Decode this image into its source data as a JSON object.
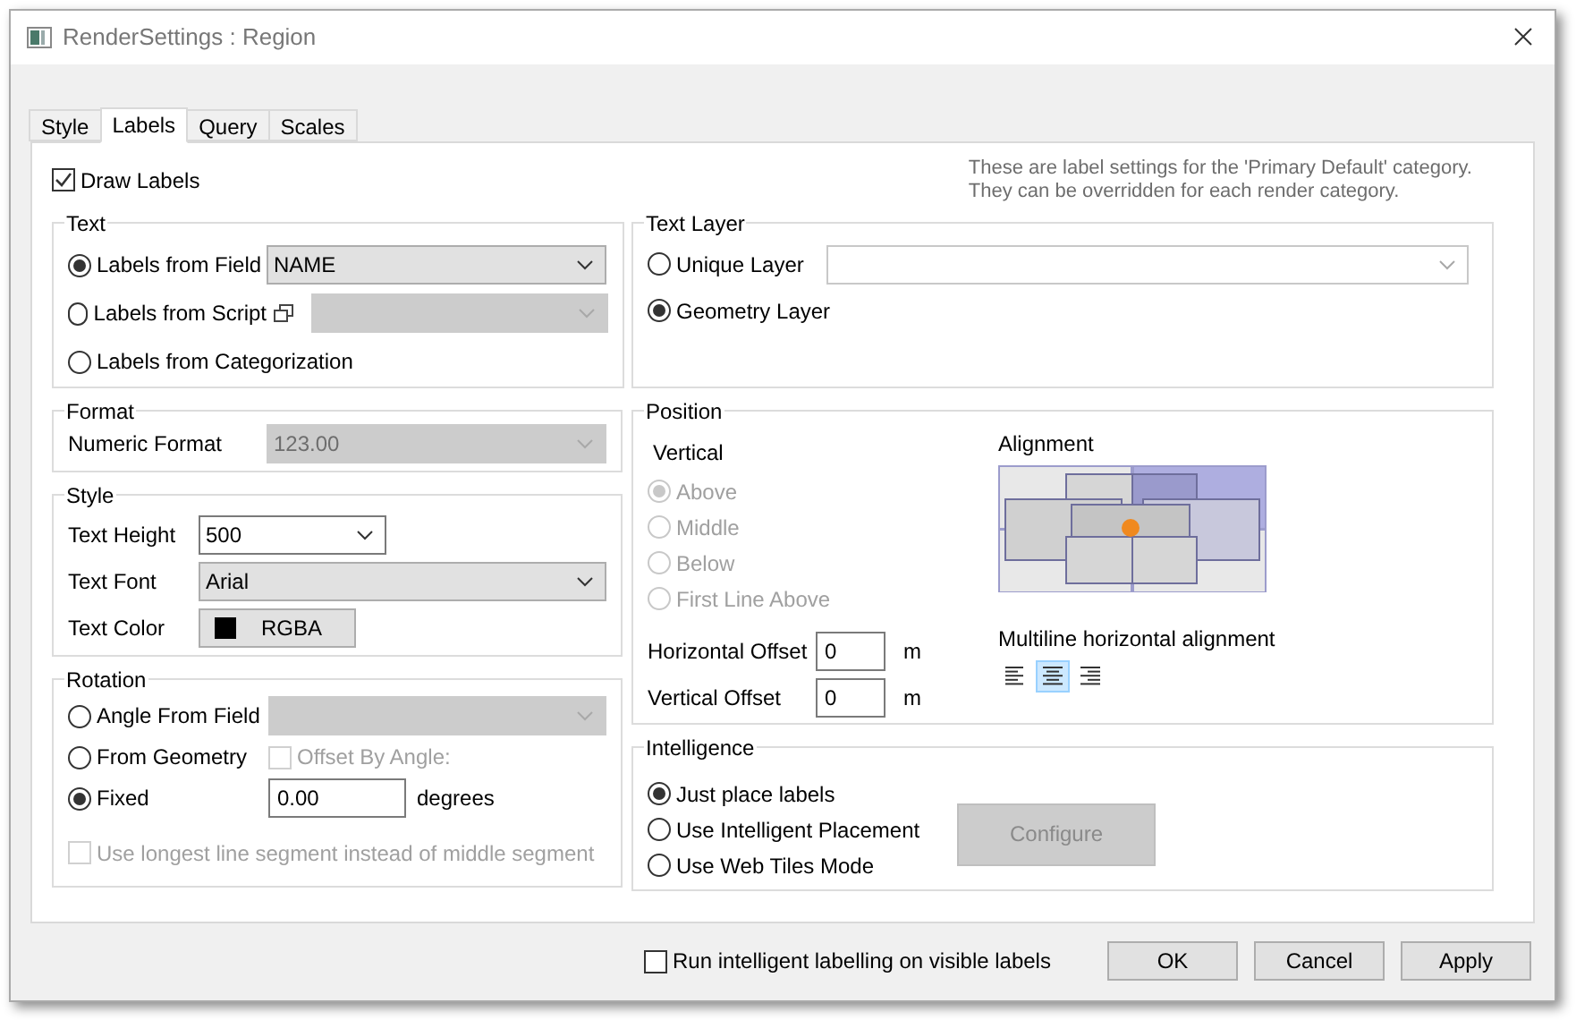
{
  "window": {
    "title": "RenderSettings : Region"
  },
  "tabs": [
    {
      "label": "Style",
      "selected": false
    },
    {
      "label": "Labels",
      "selected": true
    },
    {
      "label": "Query",
      "selected": false
    },
    {
      "label": "Scales",
      "selected": false
    }
  ],
  "draw_labels": {
    "label": "Draw Labels",
    "checked": true
  },
  "note": [
    "These are label settings for the 'Primary Default' category.",
    "They can be overridden for each render category."
  ],
  "text_group": {
    "title": "Text",
    "options": [
      {
        "label": "Labels from Field",
        "selected": true,
        "kind": "select",
        "value": "NAME",
        "disabled": false
      },
      {
        "label": "Labels from Script",
        "selected": false,
        "kind": "script",
        "disabled": true
      },
      {
        "label": "Labels from Categorization",
        "selected": false,
        "kind": "plain"
      }
    ]
  },
  "format_group": {
    "title": "Format",
    "label": "Numeric Format",
    "value": "123.00",
    "disabled": true
  },
  "style_group": {
    "title": "Style",
    "text_height": {
      "label": "Text Height",
      "value": "500"
    },
    "text_font": {
      "label": "Text Font",
      "value": "Arial"
    },
    "text_color": {
      "label": "Text Color",
      "color": "#000000",
      "button": "RGBA"
    }
  },
  "rotation_group": {
    "title": "Rotation",
    "options": [
      {
        "label": "Angle From Field",
        "selected": false,
        "kind": "select",
        "disabled": true
      },
      {
        "label": "From Geometry",
        "selected": false,
        "kind": "check",
        "check_label": "Offset By Angle:",
        "checked": false,
        "disabled": true
      },
      {
        "label": "Fixed",
        "selected": true,
        "kind": "input",
        "value": "0.00",
        "unit": "degrees"
      }
    ],
    "segment": {
      "label": "Use longest line segment instead of middle segment",
      "checked": false,
      "disabled": true
    }
  },
  "text_layer_group": {
    "title": "Text Layer",
    "options": [
      {
        "label": "Unique Layer",
        "selected": false,
        "kind": "select"
      },
      {
        "label": "Geometry Layer",
        "selected": true,
        "kind": "plain"
      }
    ]
  },
  "position_group": {
    "title": "Position",
    "vertical": {
      "title": "Vertical",
      "disabled": true,
      "options": [
        {
          "label": "Above",
          "selected": true
        },
        {
          "label": "Middle",
          "selected": false
        },
        {
          "label": "Below",
          "selected": false
        },
        {
          "label": "First Line Above",
          "selected": false
        }
      ]
    },
    "offsets": [
      {
        "label": "Horizontal Offset",
        "value": "0",
        "unit": "m"
      },
      {
        "label": "Vertical Offset",
        "value": "0",
        "unit": "m"
      }
    ],
    "alignment_title": "Alignment",
    "multiline": {
      "title": "Multiline horizontal alignment",
      "options": [
        {
          "kind": "left",
          "selected": false
        },
        {
          "kind": "center",
          "selected": true
        },
        {
          "kind": "right",
          "selected": false
        }
      ]
    }
  },
  "intelligence_group": {
    "title": "Intelligence",
    "options": [
      {
        "label": "Just place labels",
        "selected": true
      },
      {
        "label": "Use Intelligent Placement",
        "selected": false
      },
      {
        "label": "Use Web Tiles Mode",
        "selected": false
      }
    ],
    "configure": {
      "label": "Configure",
      "disabled": true
    }
  },
  "run_intelligent": {
    "label": "Run intelligent labelling on visible labels",
    "checked": false
  },
  "buttons": [
    "OK",
    "Cancel",
    "Apply"
  ]
}
